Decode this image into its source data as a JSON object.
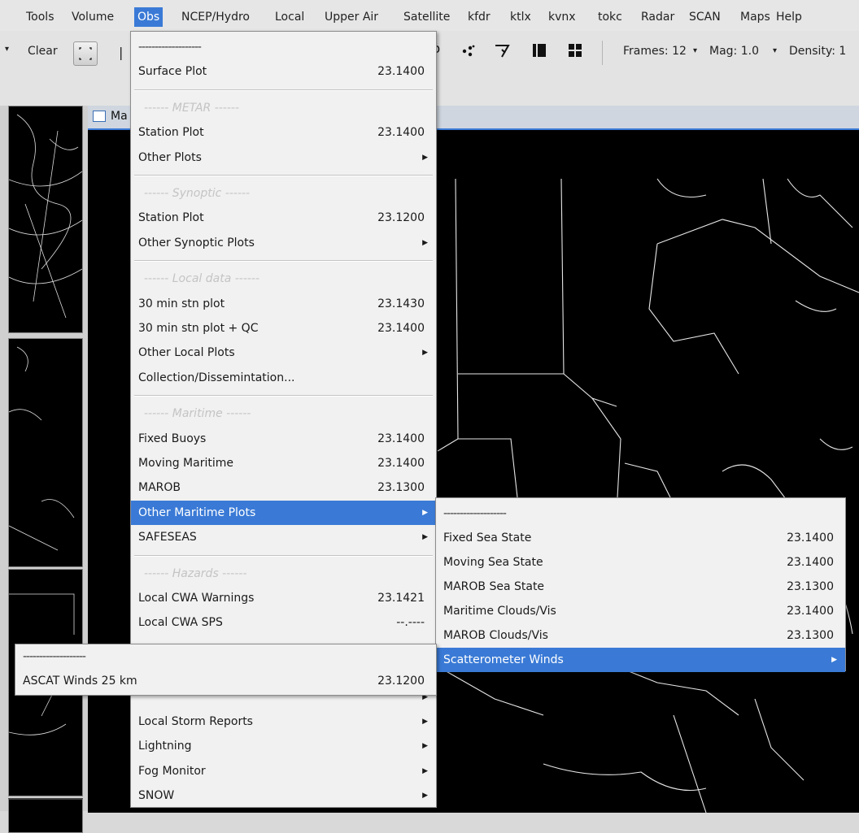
{
  "menubar": {
    "items": [
      "Tools",
      "Volume",
      "Obs",
      "NCEP/Hydro",
      "Local",
      "Upper Air",
      "Satellite",
      "kfdr",
      "ktlx",
      "kvnx",
      "tokc",
      "Radar",
      "SCAN",
      "Maps",
      "Help"
    ],
    "active": "Obs"
  },
  "toolbar": {
    "clear_label": "Clear",
    "frames_label": "Frames: 12",
    "mag_label": "Mag: 1.0",
    "density_label": "Density: 1",
    "arrow_glyph": "▾"
  },
  "map_tab": {
    "label": "Ma"
  },
  "obs_menu": {
    "items": [
      {
        "type": "tear",
        "label": "-------------------"
      },
      {
        "type": "item",
        "label": "Surface Plot",
        "value": "23.1400"
      },
      {
        "type": "section",
        "label": "------ METAR ------"
      },
      {
        "type": "item",
        "label": "Station Plot",
        "value": "23.1400"
      },
      {
        "type": "submenu",
        "label": "Other Plots"
      },
      {
        "type": "section",
        "label": "------ Synoptic ------"
      },
      {
        "type": "item",
        "label": "Station Plot",
        "value": "23.1200"
      },
      {
        "type": "submenu",
        "label": "Other Synoptic Plots"
      },
      {
        "type": "section",
        "label": "------ Local data ------"
      },
      {
        "type": "item",
        "label": "30 min stn plot",
        "value": "23.1430"
      },
      {
        "type": "item",
        "label": "30 min stn plot + QC",
        "value": "23.1400"
      },
      {
        "type": "submenu",
        "label": "Other Local Plots"
      },
      {
        "type": "item",
        "label": "Collection/Dissemintation..."
      },
      {
        "type": "section",
        "label": "------ Maritime ------"
      },
      {
        "type": "item",
        "label": "Fixed Buoys",
        "value": "23.1400"
      },
      {
        "type": "item",
        "label": "Moving Maritime",
        "value": "23.1400"
      },
      {
        "type": "item",
        "label": "MAROB",
        "value": "23.1300"
      },
      {
        "type": "submenu",
        "label": "Other Maritime Plots",
        "highlight": true
      },
      {
        "type": "submenu",
        "label": "SAFESEAS"
      },
      {
        "type": "section",
        "label": "------ Hazards ------"
      },
      {
        "type": "item",
        "label": "Local CWA Warnings",
        "value": "23.1421"
      },
      {
        "type": "item",
        "label": "Local CWA SPS",
        "value": "--.----"
      },
      {
        "type": "item",
        "label": "",
        "value": ""
      },
      {
        "type": "item",
        "label": "",
        "value": ""
      },
      {
        "type": "submenu",
        "label": ""
      },
      {
        "type": "submenu",
        "label": "Local Storm Reports"
      },
      {
        "type": "submenu",
        "label": "Lightning"
      },
      {
        "type": "submenu",
        "label": "Fog Monitor"
      },
      {
        "type": "submenu",
        "label": "SNOW"
      }
    ]
  },
  "maritime_menu": {
    "items": [
      {
        "type": "tear",
        "label": "-------------------"
      },
      {
        "type": "item",
        "label": "Fixed Sea State",
        "value": "23.1400"
      },
      {
        "type": "item",
        "label": "Moving Sea State",
        "value": "23.1400"
      },
      {
        "type": "item",
        "label": "MAROB Sea State",
        "value": "23.1300"
      },
      {
        "type": "item",
        "label": "Maritime Clouds/Vis",
        "value": "23.1400"
      },
      {
        "type": "item",
        "label": "MAROB Clouds/Vis",
        "value": "23.1300"
      },
      {
        "type": "submenu",
        "label": "Scatterometer Winds",
        "highlight": true
      }
    ]
  },
  "scat_menu": {
    "items": [
      {
        "type": "tear",
        "label": "-------------------"
      },
      {
        "type": "item",
        "label": "ASCAT Winds 25 km",
        "value": "23.1200"
      }
    ]
  }
}
